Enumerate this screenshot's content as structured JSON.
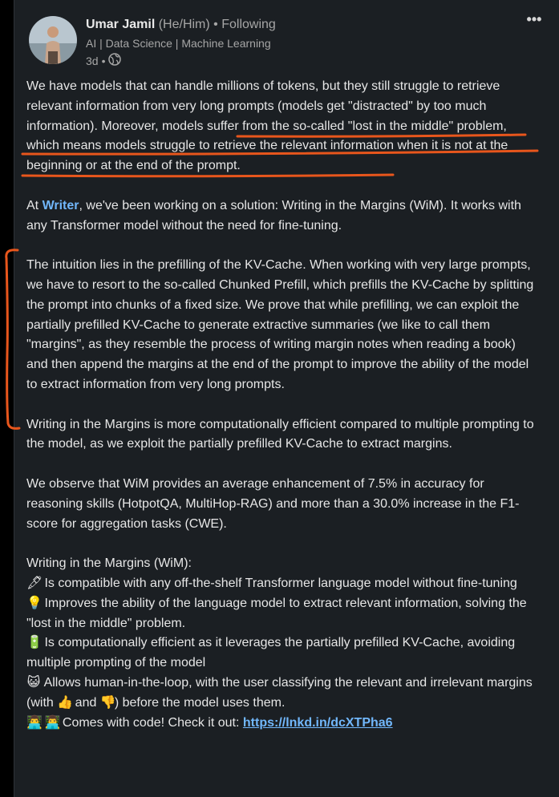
{
  "post": {
    "author": {
      "name": "Umar Jamil",
      "pronouns": "(He/Him)",
      "separator": "•",
      "follow_status": "Following",
      "headline": "AI | Data Science | Machine Learning",
      "timestamp": "3d",
      "visibility_icon": "globe-icon"
    },
    "more_icon": "more-options-icon",
    "paragraphs": {
      "p1_a": "We have models that can handle millions of tokens, but they still struggle to retrieve relevant information from very long prompts (models get \"distracted\" by too much information). Moreover, ",
      "p1_b": "models suffer from the so-called \"lost in the middle\" problem, which means models struggle to retrieve the relevant information when it is not at the beginning or at the end of the prompt.",
      "p2_a": "At ",
      "p2_writer": "Writer",
      "p2_b": ", we've been working on a solution: Writing in the Margins (WiM). It works with any Transformer model without the need for fine-tuning.",
      "p3": "The intuition lies in the prefilling of the KV-Cache. When working with very large prompts, we have to resort to the so-called Chunked Prefill, which prefills the KV-Cache by splitting the prompt into chunks of a fixed size. We prove that while prefilling, we can exploit the partially prefilled KV-Cache to generate extractive summaries (we like to call them \"margins\", as they resemble the process of writing margin notes when reading a book) and then append the margins at the end of the prompt to improve the ability of the model to extract information from very long prompts.",
      "p4": "Writing in the Margins is more computationally efficient compared to multiple prompting to the model, as we exploit the partially prefilled KV-Cache to extract margins.",
      "p5": "We observe that WiM provides an average enhancement of 7.5% in accuracy for reasoning skills (HotpotQA, MultiHop-RAG) and more than a 30.0% increase in the F1-score for aggregation tasks (CWE).",
      "list_title": "Writing in the Margins (WiM):",
      "item1": " Is compatible with any off-the-shelf Transformer language model without fine-tuning",
      "item2": " Improves the ability of the language model to extract relevant information, solving the \"lost in the middle\" problem.",
      "item3": " Is computationally efficient as it leverages the partially prefilled KV-Cache, avoiding multiple prompting of the model",
      "item4_a": " Allows human-in-the-loop, with the user classifying the relevant and irrelevant margins (with ",
      "item4_b": " and ",
      "item4_c": ") before the model uses them.",
      "item5": " Comes with code! Check it out: ",
      "link": "https://lnkd.in/dcXTPha6"
    },
    "emoji": {
      "pen": "🖋",
      "bulb": "💡",
      "battery": "🔋",
      "cat": "😺",
      "thumbs_up": "👍",
      "thumbs_down": "👎",
      "technologist": "👨‍💻"
    },
    "colors": {
      "background": "#1b1f23",
      "text": "#e6e6e6",
      "muted": "#a6a6a6",
      "link": "#71b7fb",
      "annotation": "#e8561c"
    }
  }
}
